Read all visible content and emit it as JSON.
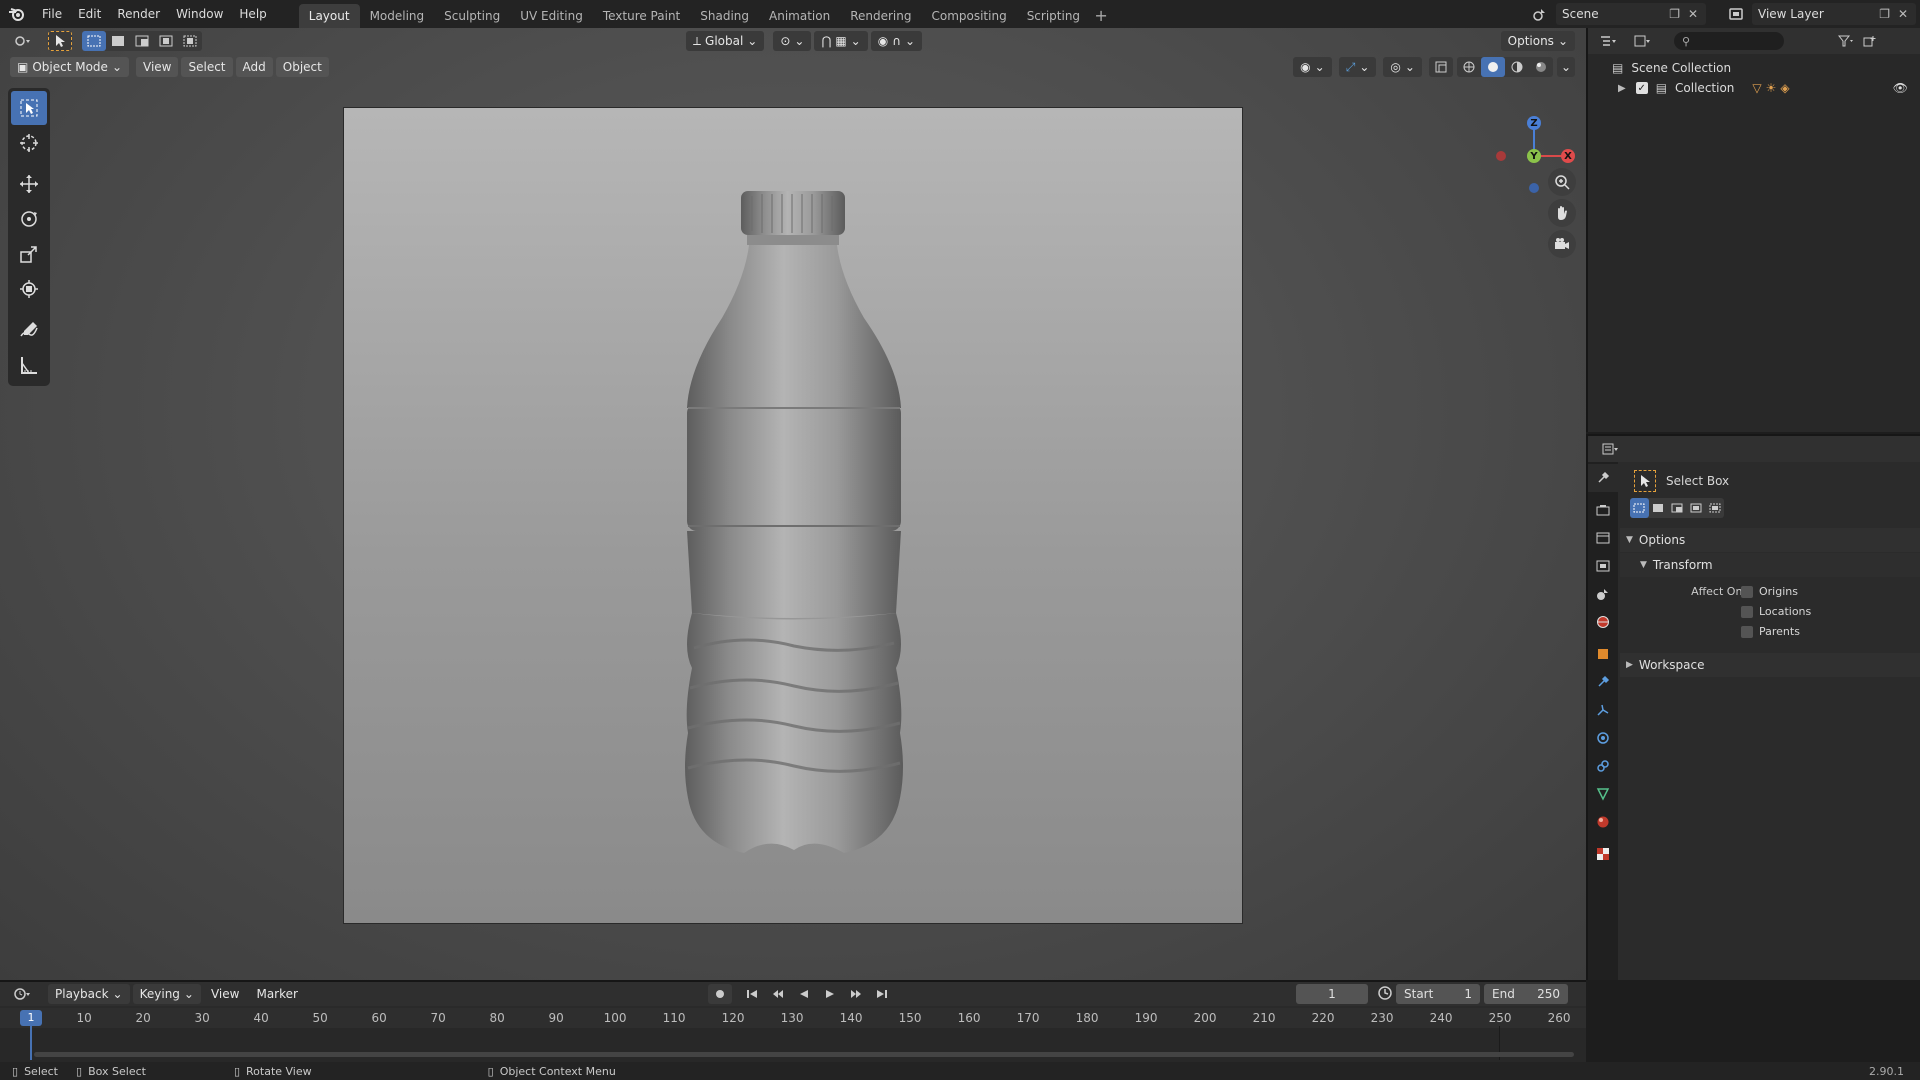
{
  "menu": {
    "items": [
      "File",
      "Edit",
      "Render",
      "Window",
      "Help"
    ]
  },
  "workspaces": {
    "tabs": [
      "Layout",
      "Modeling",
      "Sculpting",
      "UV Editing",
      "Texture Paint",
      "Shading",
      "Animation",
      "Rendering",
      "Compositing",
      "Scripting"
    ],
    "active": "Layout"
  },
  "scene": {
    "name": "Scene",
    "view_layer": "View Layer"
  },
  "viewport": {
    "mode": "Object Mode",
    "menus": [
      "View",
      "Select",
      "Add",
      "Object"
    ],
    "orientation": "Global",
    "options_label": "Options",
    "gizmo": {
      "x": "X",
      "y": "Y",
      "z": "Z"
    }
  },
  "toolbar": {
    "tools": [
      "select-box-icon",
      "cursor-icon",
      "move-icon",
      "rotate-icon",
      "scale-icon",
      "transform-icon",
      "annotate-icon",
      "measure-icon"
    ]
  },
  "outliner": {
    "scene_collection": "Scene Collection",
    "collection": "Collection"
  },
  "properties": {
    "tool_name": "Select Box",
    "options_label": "Options",
    "transform_label": "Transform",
    "affect_only_label": "Affect Only",
    "checkboxes": [
      "Origins",
      "Locations",
      "Parents"
    ],
    "workspace_label": "Workspace"
  },
  "timeline": {
    "menus": [
      "Playback",
      "Keying",
      "View",
      "Marker"
    ],
    "current_frame": "1",
    "start_label": "Start",
    "start_value": "1",
    "end_label": "End",
    "end_value": "250",
    "ruler_frames": [
      1,
      10,
      20,
      30,
      40,
      50,
      60,
      70,
      80,
      90,
      100,
      110,
      120,
      130,
      140,
      150,
      160,
      170,
      180,
      190,
      200,
      210,
      220,
      230,
      240,
      250,
      260
    ]
  },
  "status": {
    "select": "Select",
    "box_select": "Box Select",
    "rotate_view": "Rotate View",
    "context_menu": "Object Context Menu",
    "version": "2.90.1"
  }
}
